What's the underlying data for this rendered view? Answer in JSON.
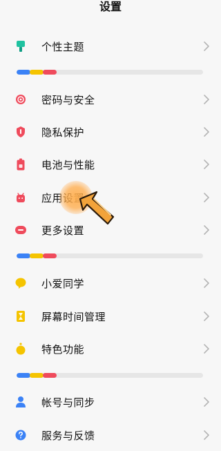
{
  "header": {
    "title": "设置"
  },
  "colors": {
    "blue": "#3b82f6",
    "yellow": "#f5c400",
    "red": "#ef4b5c",
    "green": "#1fc2a0",
    "chevron": "#b5b5b5"
  },
  "sections": [
    {
      "items": [
        {
          "label": "个性主题",
          "icon": "theme-brush-icon"
        }
      ]
    },
    {
      "items": [
        {
          "label": "密码与安全",
          "icon": "security-target-icon"
        },
        {
          "label": "隐私保护",
          "icon": "privacy-shield-icon"
        },
        {
          "label": "电池与性能",
          "icon": "battery-icon"
        },
        {
          "label": "应用设置",
          "icon": "android-app-icon"
        },
        {
          "label": "更多设置",
          "icon": "more-settings-icon"
        }
      ]
    },
    {
      "items": [
        {
          "label": "小爱同学",
          "icon": "assistant-chat-icon"
        },
        {
          "label": "屏幕时间管理",
          "icon": "hourglass-icon"
        },
        {
          "label": "特色功能",
          "icon": "special-features-icon"
        }
      ]
    },
    {
      "items": [
        {
          "label": "帐号与同步",
          "icon": "account-person-icon"
        },
        {
          "label": "服务与反馈",
          "icon": "help-question-icon"
        }
      ]
    }
  ]
}
